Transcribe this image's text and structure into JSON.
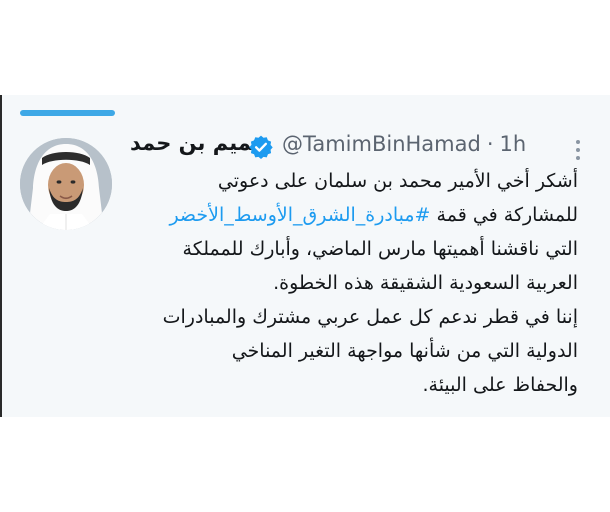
{
  "tweet": {
    "author_name": "تميم بن حمد",
    "handle": "@TamimBinHamad",
    "separator": "·",
    "time": "1h",
    "avatar_icon": "profile-photo",
    "verified_icon": "verified-badge-icon",
    "more_icon": "more-vertical-icon",
    "accent_color": "#1d9bf0",
    "lines": [
      {
        "text": "أشكر أخي الأمير محمد بن سلمان على دعوتي"
      },
      {
        "prefix": "للمشاركة في قمة ",
        "hashtag": "#مبادرة_الشرق_الأوسط_الأخضر"
      },
      {
        "text": "التي ناقشنا أهميتها مارس الماضي، وأبارك للمملكة"
      },
      {
        "text": "العربية السعودية الشقيقة هذه الخطوة."
      },
      {
        "text": "إننا في قطر ندعم كل عمل عربي مشترك والمبادرات"
      },
      {
        "text": "الدولية التي من شأنها مواجهة التغير المناخي"
      },
      {
        "text": "والحفاظ على البيئة."
      }
    ]
  }
}
